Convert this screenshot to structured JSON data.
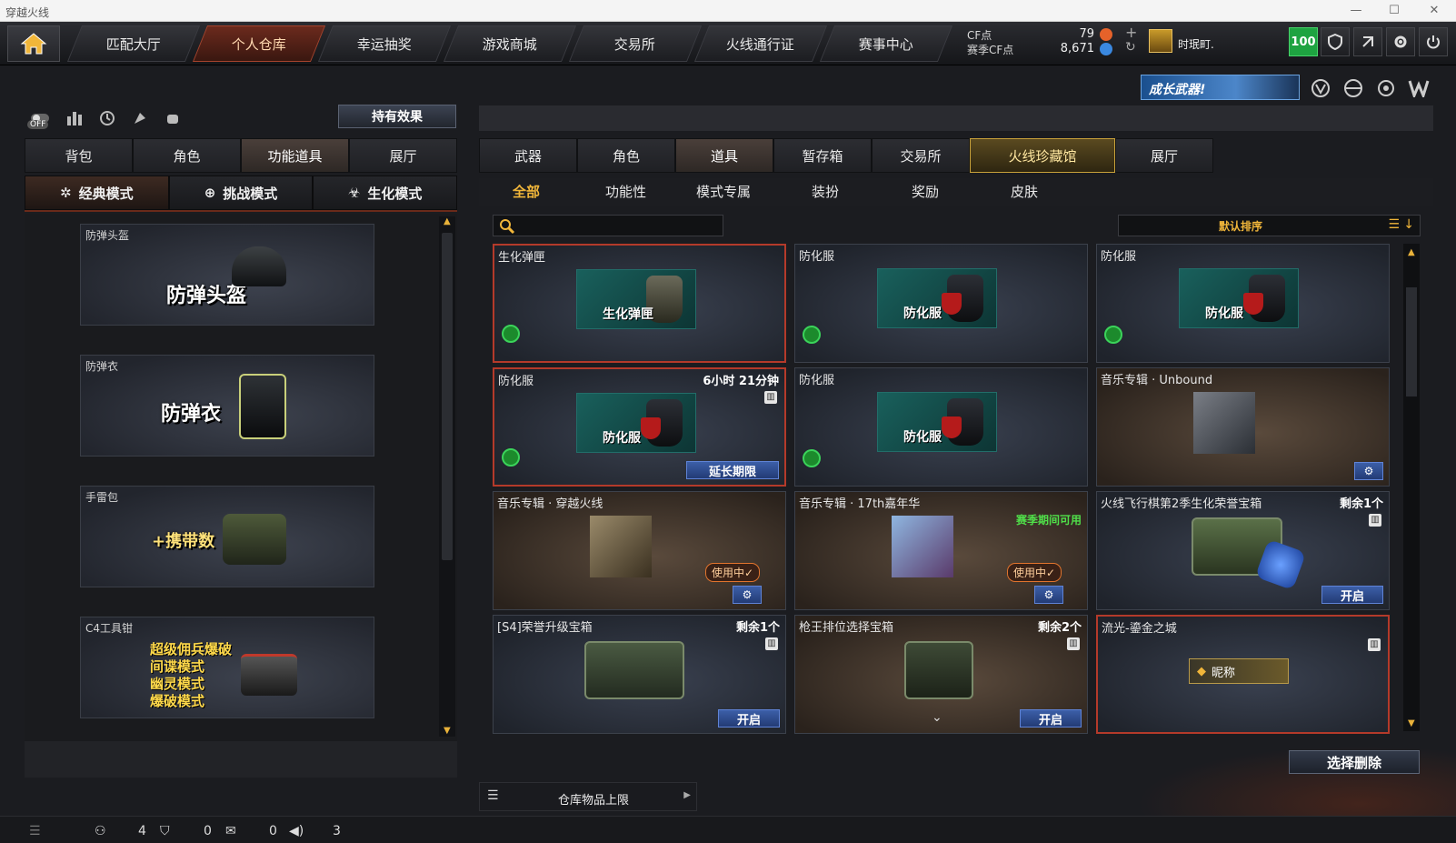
{
  "window": {
    "title": "穿越火线"
  },
  "nav": {
    "tabs": [
      "匹配大厅",
      "个人仓库",
      "幸运抽奖",
      "游戏商城",
      "交易所",
      "火线通行证",
      "赛事中心"
    ],
    "active_index": 1
  },
  "currency": {
    "cf_label": "CF点",
    "cf_value": "79",
    "season_label": "赛季CF点",
    "season_value": "8,671",
    "plus": "+"
  },
  "user": {
    "name": "时珉町.",
    "level": "100"
  },
  "banner": {
    "text": "成长武器!"
  },
  "left": {
    "off_label": "OFF",
    "effects_button": "持有效果",
    "tabs": [
      "背包",
      "角色",
      "功能道具",
      "展厅"
    ],
    "active_tab": 2,
    "modes": [
      "经典模式",
      "挑战模式",
      "生化模式"
    ],
    "items": [
      {
        "name": "防弹头盔",
        "big": "防弹头盔"
      },
      {
        "name": "防弹衣",
        "big": "防弹衣"
      },
      {
        "name": "手雷包",
        "big": "+携带数"
      },
      {
        "name": "C4工具钳",
        "lines": [
          "超级佣兵爆破",
          "间谍模式",
          "幽灵模式",
          "爆破模式"
        ]
      }
    ]
  },
  "right": {
    "tabs": [
      "武器",
      "角色",
      "道具",
      "暂存箱",
      "交易所",
      "火线珍藏馆",
      "展厅"
    ],
    "subtabs": [
      "全部",
      "功能性",
      "模式专属",
      "装扮",
      "奖励",
      "皮肤"
    ],
    "search_placeholder": "",
    "sort_label": "默认排序",
    "cards": [
      {
        "name": "生化弹匣",
        "img_label": "生化弹匣"
      },
      {
        "name": "防化服",
        "img_label": "防化服"
      },
      {
        "name": "防化服",
        "img_label": "防化服"
      },
      {
        "name": "防化服",
        "img_label": "防化服",
        "timer": "6小时 21分钟",
        "button": "延长期限"
      },
      {
        "name": "防化服",
        "img_label": "防化服"
      },
      {
        "name": "音乐专辑 · Unbound"
      },
      {
        "name": "音乐专辑 · 穿越火线",
        "status": "使用中✓"
      },
      {
        "name": "音乐专辑 · 17th嘉年华",
        "status": "使用中✓",
        "note": "赛季期间可用"
      },
      {
        "name": "火线飞行棋第2季生化荣誉宝箱",
        "count": "剩余1个",
        "button": "开启"
      },
      {
        "name": "[S4]荣誉升级宝箱",
        "count": "剩余1个",
        "button": "开启"
      },
      {
        "name": "枪王排位选择宝箱",
        "count": "剩余2个",
        "button": "开启"
      },
      {
        "name": "流光-鎏金之城",
        "nick": "昵称"
      }
    ],
    "delete_button": "选择删除",
    "capacity_label": "仓库物品上限"
  },
  "status": {
    "a": "4",
    "b": "0",
    "c": "0",
    "d": "3"
  },
  "colors": {
    "accent": "#f1b63a",
    "active_tab": "#a5432c",
    "blue_btn": "#3c5fa8",
    "green": "#1ea341"
  }
}
